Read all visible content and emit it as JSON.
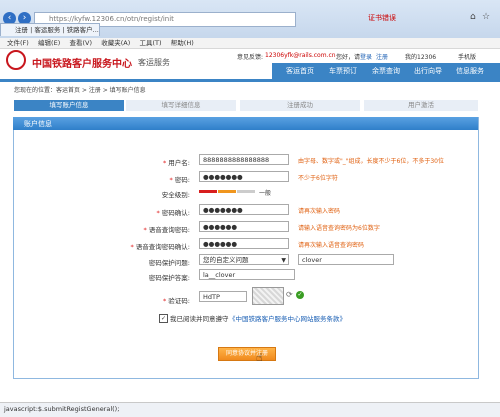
{
  "browser": {
    "url": "https://kyfw.12306.cn/otn/regist/init",
    "tab_label": "注册 | 客运服务 | 铁路客户...",
    "cert_error": "证书错误",
    "menu": [
      "文件(F)",
      "编辑(E)",
      "查看(V)",
      "收藏夹(A)",
      "工具(T)",
      "帮助(H)"
    ],
    "status_text": "javascript:$.submitRegistGeneral();"
  },
  "header": {
    "site_name": "中国铁路客户服务中心",
    "sub_name": "客运服务",
    "welcome_prefix": "意见反馈:",
    "email": "12306yfk@rails.com.cn",
    "links": [
      "您好，请",
      "登录",
      "注册",
      "我的12306",
      "手机版"
    ],
    "nav": [
      "客运首页",
      "车票预订",
      "余票查询",
      "出行向导",
      "信息服务"
    ]
  },
  "breadcrumb": "您现在的位置：客运首页 > 注册 > 填写账户信息",
  "steps": [
    "填写账户信息",
    "填写详细信息",
    "注册成功",
    "用户激活"
  ],
  "form": {
    "panel_title": "账户信息",
    "username_label": "用户名:",
    "username_value": "8888888888888888",
    "username_hint": "由字母、数字或\"_\"组成，长度不少于6位，不多于30位",
    "password_label": "密码:",
    "password_value": "●●●●●●●",
    "password_hint": "不少于6位字符",
    "security_label": "安全级别:",
    "security_level": "一般",
    "confirm_label": "密码确认:",
    "confirm_value": "●●●●●●●",
    "confirm_hint": "请再次输入密码",
    "query_pwd_label": "语音查询密码:",
    "query_pwd_value": "●●●●●●",
    "query_pwd_hint": "请输入语音查询密码为6位数字",
    "query_confirm_label": "语音查询密码确认:",
    "query_confirm_value": "●●●●●●",
    "query_confirm_hint": "请再次输入语音查询密码",
    "question_label": "密码保护问题:",
    "question_value": "您的自定义问题",
    "question_custom": "clover",
    "answer_label": "密码保护答案:",
    "answer_value": "la__clover",
    "captcha_label": "验证码:",
    "captcha_value": "HdTP",
    "agree_text": "我已阅读并同意遵守",
    "agree_link": "《中国铁路客户服务中心网站服务条款》",
    "submit_label": "同意协议并注册"
  },
  "colors": {
    "brand_blue": "#3b84c5",
    "accent_orange": "#f0961e",
    "error_red": "#e02020"
  }
}
